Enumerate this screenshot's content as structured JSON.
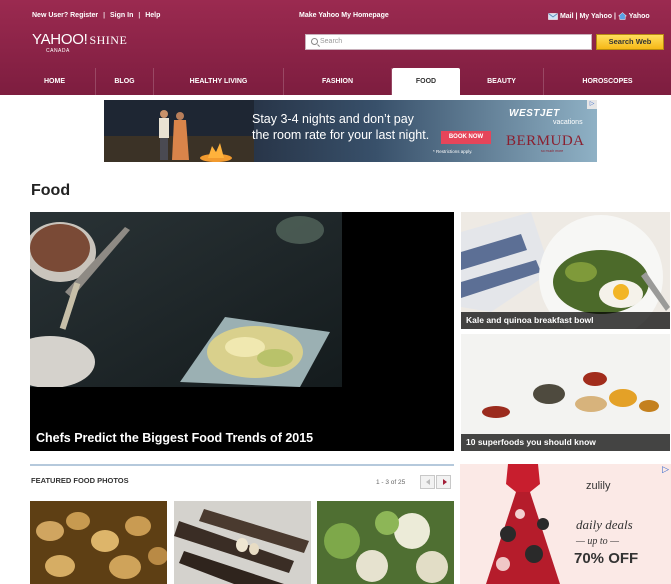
{
  "topbar": {
    "new_user": "New User? Register",
    "sep": "|",
    "sign_in": "Sign In",
    "help": "Help",
    "make_homepage": "Make Yahoo My Homepage",
    "mail": "Mail",
    "my_yahoo": "My Yahoo",
    "home": "Yahoo"
  },
  "logo": {
    "yahoo": "YAHOO!",
    "shine": "SHINE",
    "region": "CANADA"
  },
  "search": {
    "placeholder": "Search",
    "button": "Search Web"
  },
  "nav": {
    "tabs": [
      {
        "label": "HOME"
      },
      {
        "label": "BLOG"
      },
      {
        "label": "HEALTHY LIVING"
      },
      {
        "label": "FASHION"
      },
      {
        "label": "FOOD",
        "active": true
      },
      {
        "label": "BEAUTY"
      },
      {
        "label": "HOROSCOPES"
      }
    ]
  },
  "banner_ad": {
    "line1": "Stay 3-4 nights and don’t pay",
    "line2": "the room rate for your last night.",
    "cta": "BOOK NOW",
    "restrictions": "* Restrictions apply.",
    "brand": "WESTJET",
    "brand_sub": "vacations",
    "destination": "BERMUDA",
    "destination_sub": "so much more"
  },
  "page": {
    "title": "Food"
  },
  "hero": {
    "caption": "Chefs Predict the Biggest Food Trends of 2015"
  },
  "side_stories": [
    {
      "caption": "Kale and quinoa breakfast bowl"
    },
    {
      "caption": "10 superfoods you should know"
    }
  ],
  "featured": {
    "title": "FEATURED FOOD PHOTOS",
    "pager_text": "1 - 3 of 25"
  },
  "side_ad": {
    "brand": "zulily",
    "line1": "daily deals",
    "line2": "— up to —",
    "line3": "70% OFF"
  },
  "colors": {
    "header": "#8a2248",
    "search_button": "#f6c02e",
    "accent_red": "#a32038"
  }
}
